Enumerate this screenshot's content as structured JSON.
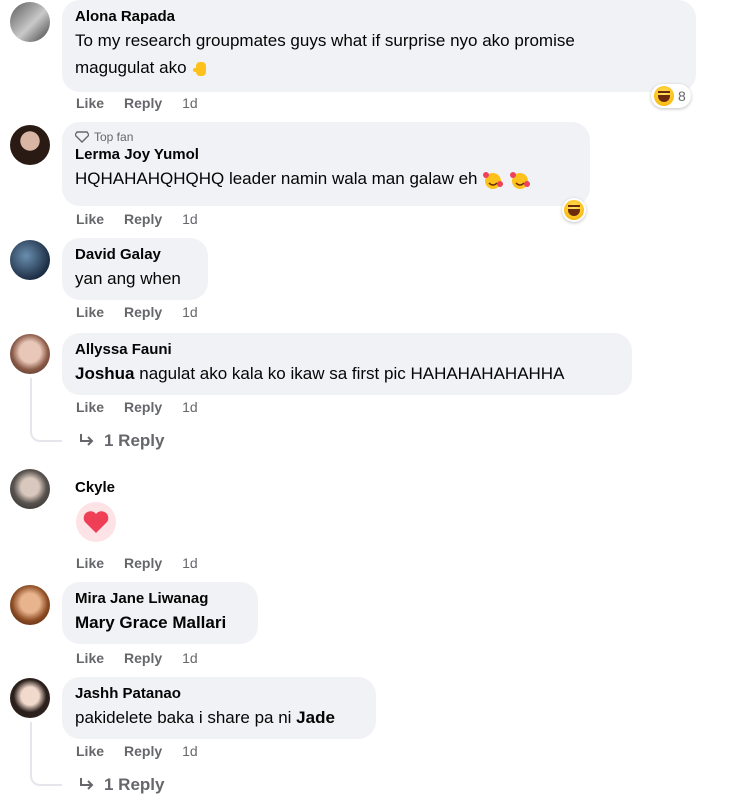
{
  "actions": {
    "like": "Like",
    "reply": "Reply"
  },
  "comments": [
    {
      "author": "Alona Rapada",
      "text_line1": "To my research groupmates guys what if surprise nyo ako promise",
      "text_line2": "magugulat ako",
      "emoji": "hand-emoji",
      "time": "1d",
      "reaction_count": "8",
      "reaction": "haha"
    },
    {
      "badge": "Top fan",
      "author": "Lerma Joy Yumol",
      "text": "HQHAHAHQHQHQ leader namin wala man galaw eh",
      "emoji": "smiling-face-with-hearts-emoji",
      "time": "1d",
      "reaction": "haha"
    },
    {
      "author": "David Galay",
      "text": "yan ang when",
      "time": "1d"
    },
    {
      "author": "Allyssa Fauni",
      "mention": "Joshua",
      "text": "nagulat ako kala ko ikaw sa first pic HAHAHAHAHAHHA",
      "time": "1d",
      "replies": "1 Reply"
    },
    {
      "author": "Ckyle",
      "sticker": "heart-sticker",
      "time": "1d"
    },
    {
      "author": "Mira Jane Liwanag",
      "mention": "Mary Grace Mallari",
      "time": "1d"
    },
    {
      "author": "Jashh Patanao",
      "text": "pakidelete baka i share pa ni",
      "mention": "Jade",
      "time": "1d",
      "replies": "1 Reply"
    }
  ]
}
